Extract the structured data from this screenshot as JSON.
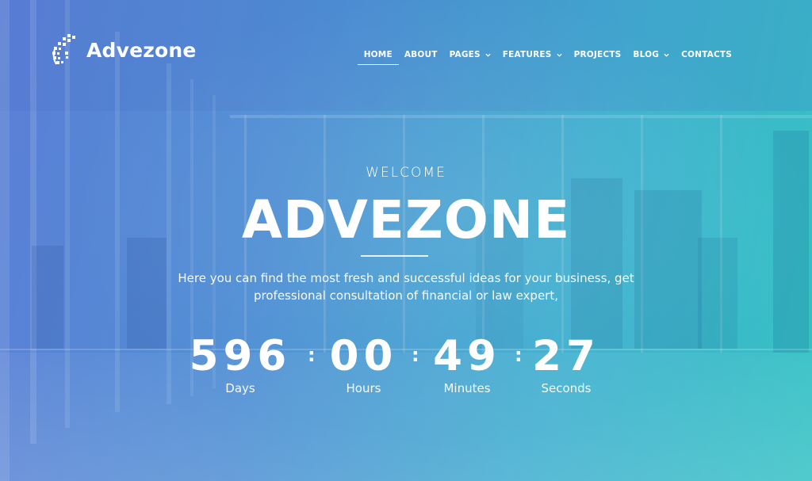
{
  "brand": {
    "name": "Advezone"
  },
  "nav": [
    {
      "label": "HOME",
      "dropdown": false,
      "active": true
    },
    {
      "label": "ABOUT",
      "dropdown": false,
      "active": false
    },
    {
      "label": "PAGES",
      "dropdown": true,
      "active": false
    },
    {
      "label": "FEATURES",
      "dropdown": true,
      "active": false
    },
    {
      "label": "PROJECTS",
      "dropdown": false,
      "active": false
    },
    {
      "label": "BLOG",
      "dropdown": true,
      "active": false
    },
    {
      "label": "CONTACTS",
      "dropdown": false,
      "active": false
    }
  ],
  "hero": {
    "eyebrow": "WELCOME",
    "title": "ADVEZONE",
    "lead_line1": "Here you can find the most fresh and successful ideas for your business, get",
    "lead_line2": "professional consultation of financial or law expert,"
  },
  "countdown": {
    "days": {
      "value": "596",
      "label": "Days"
    },
    "hours": {
      "value": "00",
      "label": "Hours"
    },
    "minutes": {
      "value": "49",
      "label": "Minutes"
    },
    "seconds": {
      "value": "27",
      "label": "Seconds"
    },
    "separator": ":"
  },
  "colors": {
    "gradient_start": "#5b7fd6",
    "gradient_end": "#35c2c4",
    "text": "#ffffff"
  }
}
